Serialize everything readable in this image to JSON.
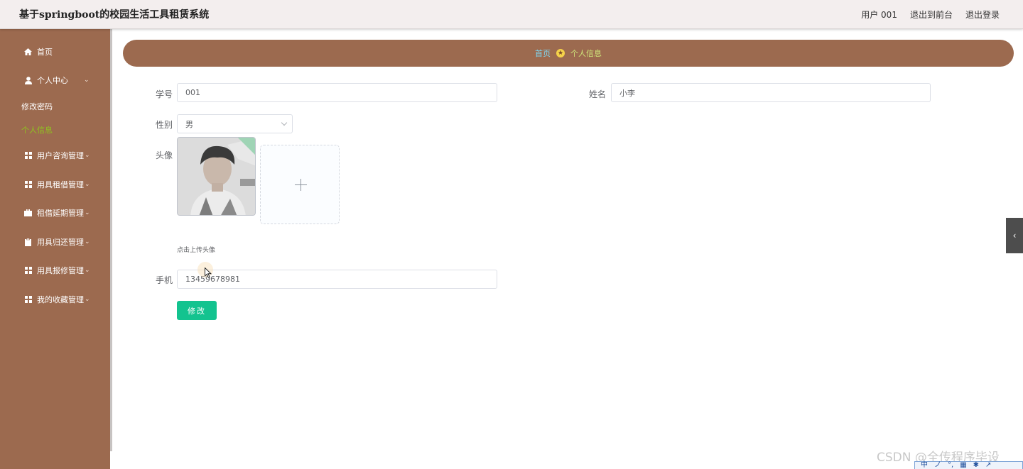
{
  "header": {
    "title": "基于springboot的校园生活工具租赁系统",
    "user_label": "用户 001",
    "front_label": "退出到前台",
    "logout_label": "退出登录"
  },
  "sidebar": {
    "home": "首页",
    "personal_center": "个人中心",
    "sub_change_password": "修改密码",
    "sub_personal_info": "个人信息",
    "consult_mgmt": "用户咨询管理",
    "rent_mgmt": "用具租借管理",
    "extend_mgmt": "租借延期管理",
    "return_mgmt": "用具归还管理",
    "repair_mgmt": "用具报修管理",
    "fav_mgmt": "我的收藏管理"
  },
  "breadcrumb": {
    "home": "首页",
    "current": "个人信息"
  },
  "form": {
    "student_id_label": "学号",
    "student_id_value": "001",
    "name_label": "姓名",
    "name_value": "小李",
    "gender_label": "性别",
    "gender_value": "男",
    "avatar_label": "头像",
    "upload_hint": "点击上传头像",
    "phone_label": "手机",
    "phone_value": "13459678981",
    "submit_label": "修改"
  },
  "overlay": {
    "watermark": "CSDN @全传程序毕设",
    "ime_items": [
      "中",
      "ノ",
      "°,",
      "▦",
      "✱",
      "↗"
    ]
  },
  "colors": {
    "sidebar_bg": "#9c6a4f",
    "active_sub": "#8fc31f",
    "submit_bg": "#13c38f",
    "crumb_home": "#7fd6f0"
  }
}
